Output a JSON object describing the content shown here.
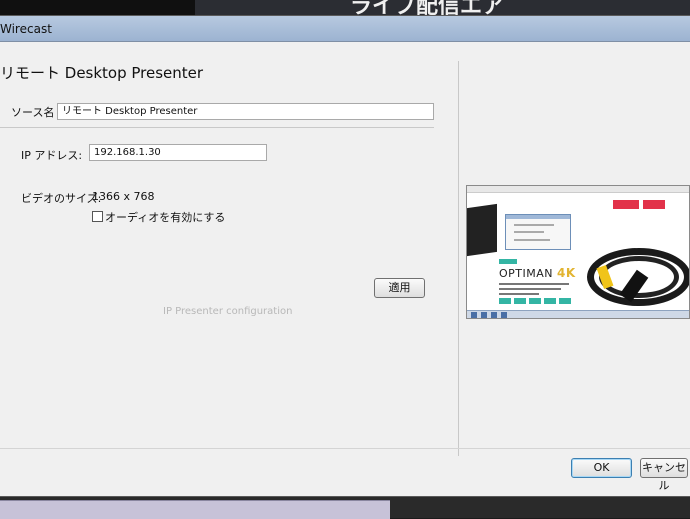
{
  "background": {
    "banner_text": "ライブ配信エア"
  },
  "window": {
    "title": "Wirecast"
  },
  "dialog": {
    "heading": "リモート Desktop Presenter",
    "source_name_label": "ソース名",
    "source_name_value": "リモート Desktop Presenter",
    "ip_label": "IP アドレス:",
    "ip_value": "192.168.1.30",
    "video_size_label": "ビデオのサイズ:",
    "video_size_value": "1366 x 768",
    "audio_checkbox_label": "オーディオを有効にする",
    "audio_enabled": false,
    "apply_label": "適用",
    "config_caption": "IP Presenter configuration"
  },
  "preview": {
    "logo_text": "OPTIMAN",
    "logo_suffix": "4K"
  },
  "footer": {
    "ok_label": "OK",
    "cancel_label": "キャンセル"
  },
  "colors": {
    "accent_teal": "#34b5a4",
    "accent_gold": "#e2b431",
    "default_button_border": "#3c7fb1"
  }
}
